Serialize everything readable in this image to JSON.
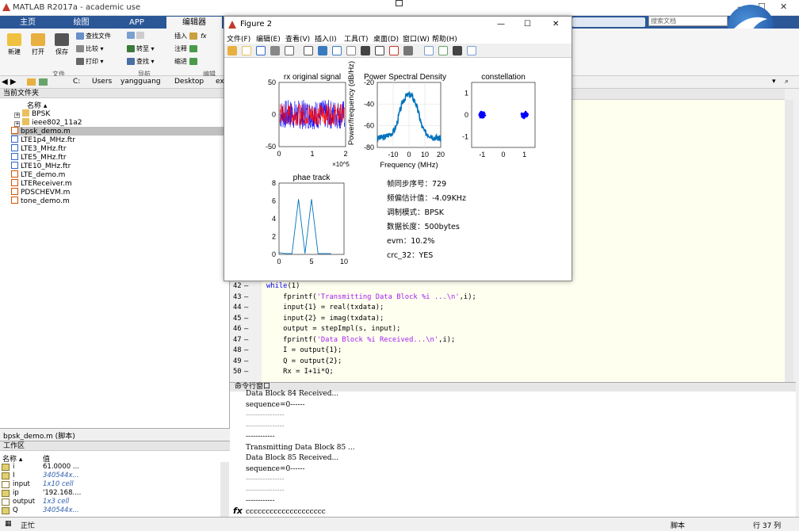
{
  "window_title": "MATLAB R2017a - academic use",
  "tabs": [
    "主页",
    "绘图",
    "APP",
    "编辑器"
  ],
  "search_placeholder": "搜索文档",
  "ribbon": {
    "new": "新建",
    "open": "打开",
    "save": "保存",
    "find_files": "查找文件",
    "compare": "比较",
    "print": "打印",
    "goto": "转至",
    "find": "查找",
    "insert": "插入",
    "comment": "注释",
    "indent": "缩进",
    "sec_file": "文件",
    "sec_nav": "导航",
    "sec_edit": "编辑"
  },
  "address": {
    "path": [
      "C:",
      "Users",
      "yangguang",
      "Desktop",
      "ex"
    ]
  },
  "current_folder": {
    "title": "当前文件夹",
    "col_name": "名称 ▴",
    "folders": [
      "BPSK",
      "ieee802_11a2"
    ],
    "files": [
      "bpsk_demo.m",
      "LTE1p4_MHz.ftr",
      "LTE3_MHz.ftr",
      "LTE5_MHz.ftr",
      "LTE10_MHz.ftr",
      "LTE_demo.m",
      "LTEReceiver.m",
      "PDSCHEVM.m",
      "tone_demo.m"
    ]
  },
  "detail_label": "bpsk_demo.m (脚本)",
  "workspace": {
    "title": "工作区",
    "col_name": "名称 ▴",
    "col_value": "值",
    "rows": [
      {
        "name": "i",
        "value": "61.0000 ..."
      },
      {
        "name": "I",
        "value": "340544x..."
      },
      {
        "name": "input",
        "value": "1x10 cell"
      },
      {
        "name": "ip",
        "value": "'192.168...."
      },
      {
        "name": "output",
        "value": "1x3 cell"
      },
      {
        "name": "Q",
        "value": "340544x..."
      }
    ]
  },
  "status": {
    "busy": "正忙",
    "script": "脚本",
    "position": "行 37 列"
  },
  "editor": {
    "lines": [
      {
        "num": "42",
        "segs": [
          {
            "t": "while",
            "c": "kw"
          },
          {
            "t": "(1)",
            "c": ""
          }
        ]
      },
      {
        "num": "43",
        "segs": [
          {
            "t": "    fprintf(",
            "c": ""
          },
          {
            "t": "'Transmitting Data Block %i ...\\n'",
            "c": "str"
          },
          {
            "t": ",i);",
            "c": ""
          }
        ]
      },
      {
        "num": "44",
        "segs": [
          {
            "t": "    input{1} = real(txdata);",
            "c": ""
          }
        ]
      },
      {
        "num": "45",
        "segs": [
          {
            "t": "    input{2} = imag(txdata);",
            "c": ""
          }
        ]
      },
      {
        "num": "46",
        "segs": [
          {
            "t": "    output = stepImpl(s, input);",
            "c": ""
          }
        ]
      },
      {
        "num": "47",
        "segs": [
          {
            "t": "    fprintf(",
            "c": ""
          },
          {
            "t": "'Data Block %i Received...\\n'",
            "c": "str"
          },
          {
            "t": ",i);",
            "c": ""
          }
        ]
      },
      {
        "num": "48",
        "segs": [
          {
            "t": "    I = output{1};",
            "c": ""
          }
        ]
      },
      {
        "num": "49",
        "segs": [
          {
            "t": "    Q = output{2};",
            "c": ""
          }
        ]
      },
      {
        "num": "50",
        "segs": [
          {
            "t": "    Rx = I+1i*Q;",
            "c": ""
          }
        ]
      }
    ]
  },
  "command_window": {
    "title": "命令行窗口",
    "lines": [
      "Data Block 84 Received...",
      "sequence=0------",
      "----------------",
      "----------------",
      "------------",
      "Transmitting Data Block 85 ...",
      "Data Block 85 Received...",
      "sequence=0------",
      "----------------",
      "----------------",
      "------------",
      "cccccccccccccccccccc"
    ],
    "prompt": "fx"
  },
  "figure": {
    "title": "Figure 2",
    "menu": [
      "文件(F)",
      "编辑(E)",
      "查看(V)",
      "插入(I)",
      "工具(T)",
      "桌面(D)",
      "窗口(W)",
      "帮助(H)"
    ],
    "info": [
      "帧同步序号：729",
      "频偏估计值：-4.09KHz",
      "调制模式：BPSK",
      "数据长度：500bytes",
      "evm：10.2%",
      "crc_32：YES"
    ]
  },
  "chart_data": [
    {
      "type": "line",
      "title": "rx original signal",
      "xlim": [
        0,
        200000
      ],
      "ylim": [
        -50,
        50
      ],
      "xticks": [
        "0",
        "1",
        "2"
      ],
      "yticks": [
        "50",
        "0",
        "-50"
      ],
      "x_exponent": "×10^5",
      "series": [
        {
          "color": "#0000ff"
        },
        {
          "color": "#ff0000"
        }
      ],
      "amplitude": 23
    },
    {
      "type": "line",
      "title": "Power Spectral Density",
      "xlabel": "Frequency (MHz)",
      "ylabel": "Power/frequency (dB/Hz)",
      "xlim": [
        -20,
        20
      ],
      "ylim": [
        -80,
        -20
      ],
      "xticks": [
        "-10",
        "0",
        "10",
        "20"
      ],
      "yticks": [
        "-20",
        "-40",
        "-60",
        "-80"
      ],
      "x": [
        -20,
        -15,
        -10,
        -8,
        -6,
        -4,
        -2,
        0,
        2,
        4,
        6,
        8,
        10,
        15,
        20
      ],
      "y": [
        -72,
        -70,
        -66,
        -60,
        -48,
        -38,
        -33,
        -31,
        -33,
        -38,
        -48,
        -60,
        -66,
        -70,
        -72
      ]
    },
    {
      "type": "scatter",
      "title": "constellation",
      "xlim": [
        -1.5,
        1.5
      ],
      "ylim": [
        -1.5,
        1.5
      ],
      "xticks": [
        "-1",
        "0",
        "1"
      ],
      "yticks": [
        "1",
        "0",
        "-1"
      ],
      "clusters": [
        {
          "x": -1,
          "y": 0
        },
        {
          "x": 1,
          "y": 0
        }
      ]
    },
    {
      "type": "line",
      "title": "phae track",
      "xlim": [
        0,
        10
      ],
      "ylim": [
        0,
        8
      ],
      "xticks": [
        "0",
        "5",
        "10"
      ],
      "yticks": [
        "8",
        "6",
        "4",
        "2",
        "0"
      ],
      "x": [
        0,
        1,
        2,
        3,
        4,
        5,
        6,
        7,
        8
      ],
      "y": [
        0.2,
        0.1,
        0.1,
        6.2,
        0.1,
        6.2,
        0.1,
        0.1,
        0.1
      ]
    }
  ]
}
